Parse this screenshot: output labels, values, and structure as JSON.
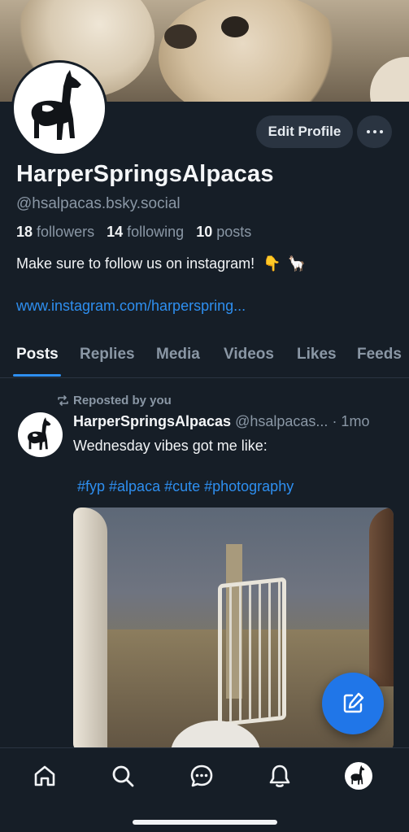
{
  "profile": {
    "display_name": "HarperSpringsAlpacas",
    "handle": "@hsalpacas.bsky.social",
    "followers_count": "18",
    "followers_label": "followers",
    "following_count": "14",
    "following_label": "following",
    "posts_count": "10",
    "posts_label": "posts",
    "bio": "Make sure to follow us on instagram!",
    "bio_emojis": [
      "👇",
      "🦙"
    ],
    "link": "www.instagram.com/harperspring...",
    "edit_label": "Edit Profile"
  },
  "tabs": [
    "Posts",
    "Replies",
    "Media",
    "Videos",
    "Likes",
    "Feeds"
  ],
  "post": {
    "repost_label": "Reposted by you",
    "author_name": "HarperSpringsAlpacas",
    "author_handle": "@hsalpacas...",
    "time": "· 1mo",
    "text": "Wednesday vibes got me like:",
    "tags": "#fyp #alpaca #cute #photography"
  },
  "icons": {
    "more": "ellipsis-icon",
    "repost": "repost-icon",
    "compose": "compose-icon",
    "nav": [
      "home-icon",
      "search-icon",
      "chat-icon",
      "bell-icon",
      "profile-avatar"
    ]
  },
  "colors": {
    "background": "#161e27",
    "accent": "#2e8ff0",
    "fab": "#2076e8",
    "muted_text": "#8a97a5"
  }
}
